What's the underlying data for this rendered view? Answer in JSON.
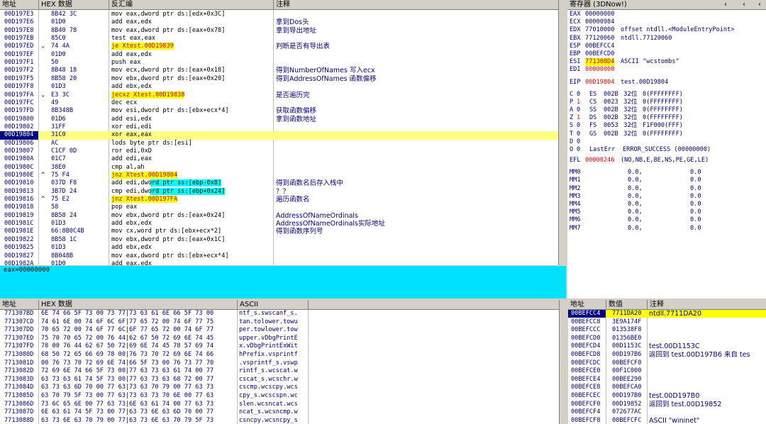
{
  "disasm": {
    "headers": [
      "地址",
      "HEX 数据",
      "反汇编",
      "注释"
    ],
    "rows": [
      {
        "addr": "00D197E3",
        "jmp": "",
        "hex": "8B42 3C",
        "asm": "mov eax,dword ptr ds:[edx+0x3C]",
        "cmt": ""
      },
      {
        "addr": "00D197E6",
        "jmp": "",
        "hex": "01D0",
        "asm": "add eax,edx",
        "cmt": "拿到Dos头"
      },
      {
        "addr": "00D197E8",
        "jmp": "",
        "hex": "8B40 78",
        "asm": "mov eax,dword ptr ds:[eax+0x78]",
        "cmt": "拿到导出地址"
      },
      {
        "addr": "00D197EB",
        "jmp": "",
        "hex": "85C0",
        "asm": "test eax,eax",
        "cmt": ""
      },
      {
        "addr": "00D197ED",
        "jmp": "⌄",
        "hex": "74 4A",
        "asm": "je Xtest.00D19839",
        "cmt": "判断是否有导出表",
        "hl": "y"
      },
      {
        "addr": "00D197EF",
        "jmp": "",
        "hex": "01D0",
        "asm": "add eax,edx",
        "cmt": ""
      },
      {
        "addr": "00D197F1",
        "jmp": "",
        "hex": "50",
        "asm": "push eax",
        "cmt": ""
      },
      {
        "addr": "00D197F2",
        "jmp": "",
        "hex": "8B48 18",
        "asm": "mov ecx,dword ptr ds:[eax+0x18]",
        "cmt": "得到NumberOfNames 写入ecx"
      },
      {
        "addr": "00D197F5",
        "jmp": "",
        "hex": "8B58 20",
        "asm": "mov ebx,dword ptr ds:[eax+0x20]",
        "cmt": "得到AddressOfNames 函数偏移"
      },
      {
        "addr": "00D197F8",
        "jmp": "",
        "hex": "01D3",
        "asm": "add ebx,edx",
        "cmt": ""
      },
      {
        "addr": "00D197FA",
        "jmp": "⌄",
        "hex": "E3 3C",
        "asm": "jecxz Xtest.00D19838",
        "cmt": "是否遍历完",
        "hl": "y"
      },
      {
        "addr": "00D197FC",
        "jmp": "",
        "hex": "49",
        "asm": "dec ecx",
        "cmt": ""
      },
      {
        "addr": "00D197FD",
        "jmp": "",
        "hex": "8B348B",
        "asm": "mov esi,dword ptr ds:[ebx+ecx*4]",
        "cmt": "获取函数偏移"
      },
      {
        "addr": "00D19800",
        "jmp": "",
        "hex": "01D6",
        "asm": "add esi,edx",
        "cmt": "拿到函数地址"
      },
      {
        "addr": "00D19802",
        "jmp": "",
        "hex": "31FF",
        "asm": "xor edi,edi",
        "cmt": ""
      },
      {
        "addr": "00D19804",
        "jmp": "",
        "hex": "31C0",
        "asm": "xor eax,eax",
        "cmt": "",
        "cur": true
      },
      {
        "addr": "00D19806",
        "jmp": "",
        "hex": "AC",
        "asm": "lods byte ptr ds:[esi]",
        "cmt": ""
      },
      {
        "addr": "00D19807",
        "jmp": "",
        "hex": "C1CF 0D",
        "asm": "ror edi,0xD",
        "cmt": ""
      },
      {
        "addr": "00D1980A",
        "jmp": "",
        "hex": "01C7",
        "asm": "add edi,eax",
        "cmt": ""
      },
      {
        "addr": "00D1980C",
        "jmp": "",
        "hex": "38E0",
        "asm": "cmp al,ah",
        "cmt": ""
      },
      {
        "addr": "00D1980E",
        "jmp": "^",
        "hex": "75 F4",
        "asm": "jnz Xtest.00D19804",
        "cmt": "",
        "hl": "y"
      },
      {
        "addr": "00D19810",
        "jmp": "",
        "hex": "037D F8",
        "asm": "add edi,dword ptr ss:[ebp-0x8]",
        "cmt": "得到函数名后存入栈中",
        "hl": "b"
      },
      {
        "addr": "00D19813",
        "jmp": "",
        "hex": "3B7D 24",
        "asm": "cmp edi,dword ptr ss:[ebp+0x24]",
        "cmt": "？？",
        "hl": "b"
      },
      {
        "addr": "00D19816",
        "jmp": "^",
        "hex": "75 E2",
        "asm": "jnz Xtest.00D197FA",
        "cmt": "遍历函数名",
        "hl": "y"
      },
      {
        "addr": "00D19818",
        "jmp": "",
        "hex": "58",
        "asm": "pop eax",
        "cmt": ""
      },
      {
        "addr": "00D19819",
        "jmp": "",
        "hex": "8B58 24",
        "asm": "mov ebx,dword ptr ds:[eax+0x24]",
        "cmt": "AddressOfNameOrdinals"
      },
      {
        "addr": "00D1981C",
        "jmp": "",
        "hex": "01D3",
        "asm": "add ebx,edx",
        "cmt": "AddressOfNameOrdinals实际地址"
      },
      {
        "addr": "00D1981E",
        "jmp": "",
        "hex": "66:8B0C4B",
        "asm": "mov cx,word ptr ds:[ebx+ecx*2]",
        "cmt": "得到函数序列号"
      },
      {
        "addr": "00D19822",
        "jmp": "",
        "hex": "8B58 1C",
        "asm": "mov ebx,dword ptr ds:[eax+0x1C]",
        "cmt": ""
      },
      {
        "addr": "00D19825",
        "jmp": "",
        "hex": "01D3",
        "asm": "add ebx,edx",
        "cmt": ""
      },
      {
        "addr": "00D19827",
        "jmp": "",
        "hex": "8B048B",
        "asm": "mov eax,dword ptr ds:[ebx+ecx*4]",
        "cmt": ""
      },
      {
        "addr": "00D1982A",
        "jmp": "",
        "hex": "01D0",
        "asm": "add eax,edx",
        "cmt": ""
      }
    ],
    "info": "eax=00000000"
  },
  "registers": {
    "title": "寄存器 (3DNow!)",
    "gp": [
      {
        "name": "EAX",
        "val": "00000000",
        "cmt": ""
      },
      {
        "name": "ECX",
        "val": "00000984",
        "cmt": ""
      },
      {
        "name": "EDX",
        "val": "77010000",
        "cmt": "offset ntdll.<ModuleEntryPoint>"
      },
      {
        "name": "EBX",
        "val": "77120060",
        "cmt": "ntdll.77120060"
      },
      {
        "name": "ESP",
        "val": "00BEFCC4",
        "cmt": ""
      },
      {
        "name": "EBP",
        "val": "00BEFCD0",
        "cmt": ""
      },
      {
        "name": "ESI",
        "val": "771308D4",
        "cmt": "ASCII \"wcstombs\""
      },
      {
        "name": "EDI",
        "val": "00000000",
        "cmt": ""
      }
    ],
    "eip": {
      "name": "EIP",
      "val": "00D19804",
      "cmt": "test.00D19804"
    },
    "flags": [
      {
        "f": "C",
        "v": "0",
        "seg": "ES",
        "sv": "002B",
        "bits": "32位",
        "range": "0(FFFFFFFF)"
      },
      {
        "f": "P",
        "v": "1",
        "seg": "CS",
        "sv": "0023",
        "bits": "32位",
        "range": "0(FFFFFFFF)"
      },
      {
        "f": "A",
        "v": "0",
        "seg": "SS",
        "sv": "002B",
        "bits": "32位",
        "range": "0(FFFFFFFF)"
      },
      {
        "f": "Z",
        "v": "1",
        "seg": "DS",
        "sv": "002B",
        "bits": "32位",
        "range": "0(FFFFFFFF)"
      },
      {
        "f": "S",
        "v": "0",
        "seg": "FS",
        "sv": "0053",
        "bits": "32位",
        "range": "F1F000(FFF)"
      },
      {
        "f": "T",
        "v": "0",
        "seg": "GS",
        "sv": "002B",
        "bits": "32位",
        "range": "0(FFFFFFFF)"
      },
      {
        "f": "D",
        "v": "0",
        "seg": "",
        "sv": "",
        "bits": "",
        "range": ""
      },
      {
        "f": "O",
        "v": "0",
        "seg": "LastErr",
        "sv": "ERROR_SUCCESS (00000000)",
        "bits": "",
        "range": ""
      }
    ],
    "efl": {
      "name": "EFL",
      "val": "00000246",
      "cmt": "(NO,NB,E,BE,NS,PE,GE,LE)"
    },
    "mm": [
      {
        "name": "MM0",
        "a": "0.0,",
        "b": "0.0"
      },
      {
        "name": "MM1",
        "a": "0.0,",
        "b": "0.0"
      },
      {
        "name": "MM2",
        "a": "0.0,",
        "b": "0.0"
      },
      {
        "name": "MM3",
        "a": "0.0,",
        "b": "0.0"
      },
      {
        "name": "MM4",
        "a": "0.0,",
        "b": "0.0"
      },
      {
        "name": "MM5",
        "a": "0.0,",
        "b": "0.0"
      },
      {
        "name": "MM6",
        "a": "0.0,",
        "b": "0.0"
      },
      {
        "name": "MM7",
        "a": "0.0,",
        "b": "0.0"
      }
    ]
  },
  "dump": {
    "headers": [
      "地址",
      "HEX 数据",
      "ASCII"
    ],
    "rows": [
      {
        "addr": "771307BD",
        "hex": "6E 74 66 5F 73 00 73 77|73 63 61 6E 66 5F 73 00",
        "ascii": "ntf_s.swscanf_s."
      },
      {
        "addr": "771307CD",
        "hex": "74 61 6E 00 74 6F 6C 6F|77 65 72 00 74 6F 77 75",
        "ascii": "tan.tolower.towu"
      },
      {
        "addr": "771307DD",
        "hex": "70 65 72 00 74 6F 77 6C|6F 77 65 72 00 74 6F 77",
        "ascii": "per.towlower.tow"
      },
      {
        "addr": "771307ED",
        "hex": "75 70 70 65 72 00 76 44|62 67 50 72 69 6E 74 45",
        "ascii": "upper.vDbgPrintE"
      },
      {
        "addr": "771307FD",
        "hex": "78 00 76 44 62 67 50 72|69 6E 74 45 78 57 69 74",
        "ascii": "x.vDbgPrintExWit"
      },
      {
        "addr": "7713080D",
        "hex": "68 50 72 65 66 69 78 00|76 73 70 72 69 6E 74 66",
        "ascii": "hPrefix.vsprintf"
      },
      {
        "addr": "7713081D",
        "hex": "00 76 73 70 72 69 6E 74|66 5F 73 00 76 73 77 70",
        "ascii": ".vsprintf_s.vswp"
      },
      {
        "addr": "7713082D",
        "hex": "72 69 6E 74 66 5F 73 00|77 63 73 63 61 74 00 77",
        "ascii": "rintf_s.wcscat.w"
      },
      {
        "addr": "7713083D",
        "hex": "63 73 63 61 74 5F 73 00|77 63 73 63 68 72 00 77",
        "ascii": "cscat_s.wcschr.w"
      },
      {
        "addr": "7713084D",
        "hex": "63 73 63 6D 70 00 77 63|73 63 70 79 00 77 63 73",
        "ascii": "cscmp.wcscpy.wcs"
      },
      {
        "addr": "7713085D",
        "hex": "63 70 79 5F 73 00 77 63|73 63 73 70 6E 00 77 63",
        "ascii": "cpy_s.wcscspn.wc"
      },
      {
        "addr": "7713086D",
        "hex": "73 6C 65 6E 00 77 63 73|6E 63 61 74 00 77 63 73",
        "ascii": "slen.wcsncat.wcs"
      },
      {
        "addr": "7713087D",
        "hex": "6E 63 61 74 5F 73 00 77|63 73 6E 63 6D 70 00 77",
        "ascii": "ncat_s.wcsncmp.w"
      },
      {
        "addr": "7713088D",
        "hex": "63 73 6E 63 70 79 00 77|63 73 6E 63 70 79 5F 73",
        "ascii": "csncpy.wcsncpy_s"
      }
    ]
  },
  "stack": {
    "headers": [
      "地址",
      "数值",
      "注释"
    ],
    "rows": [
      {
        "addr": "00BEFCC4",
        "val": "7711DA20",
        "cmt": "ntdll.7711DA20",
        "top": true
      },
      {
        "addr": "00BEFCC8",
        "val": "3E9A174F",
        "cmt": ""
      },
      {
        "addr": "00BEFCCC",
        "val": "013538F8",
        "cmt": ""
      },
      {
        "addr": "00BEFCD0",
        "val": "01356BE0",
        "cmt": ""
      },
      {
        "addr": "00BEFCD4",
        "val": "00D1153C",
        "cmt": "test.00D1153C"
      },
      {
        "addr": "00BEFCD8",
        "val": "00D197B6",
        "cmt": "返回到 test.00D197B6 来自 tes"
      },
      {
        "addr": "00BEFCDC",
        "val": "00BEFCF0",
        "cmt": ""
      },
      {
        "addr": "00BEFCE0",
        "val": "00F1C000",
        "cmt": ""
      },
      {
        "addr": "00BEFCE4",
        "val": "00BEE290",
        "cmt": ""
      },
      {
        "addr": "00BEFCE8",
        "val": "00BEFCA0",
        "cmt": ""
      },
      {
        "addr": "00BEFCEC",
        "val": "00D197B0",
        "cmt": "test.00D197B0"
      },
      {
        "addr": "00BEFCF0",
        "val": "00D19852",
        "cmt": "返回到 test.00D19852"
      },
      {
        "addr": "00BEFCF4",
        "val": "072677AC",
        "cmt": ""
      },
      {
        "addr": "00BEFCF8",
        "val": "00BEFCFC",
        "cmt": "ASCII \"wininet\""
      }
    ]
  }
}
